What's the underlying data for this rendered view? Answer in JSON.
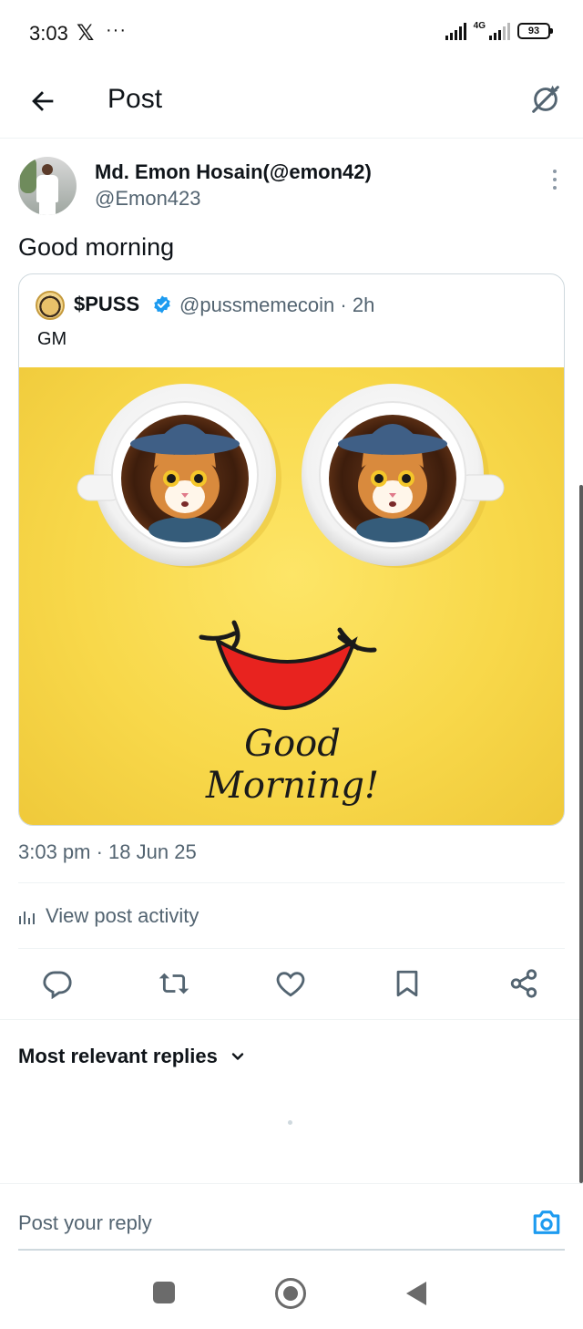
{
  "status_bar": {
    "time": "3:03",
    "app_glyph": "𝕏",
    "dots": "···",
    "network": "4G",
    "battery": "93"
  },
  "header": {
    "title": "Post",
    "icons": [
      "back-arrow-icon",
      "grok-icon"
    ]
  },
  "post": {
    "author_name": "Md. Emon Hosain(@emon42)",
    "author_handle": "@Emon423",
    "text": "Good morning",
    "timestamp": "3:03 pm · 18 Jun 25",
    "view_activity_label": "View post activity"
  },
  "quoted": {
    "name": "$PUSS",
    "handle_time": "@pussmemecoin · 2h",
    "text": "GM",
    "image_caption": "Good Morning!"
  },
  "actions": [
    "reply-icon",
    "repost-icon",
    "like-icon",
    "bookmark-icon",
    "share-icon"
  ],
  "replies": {
    "sort_label": "Most relevant replies"
  },
  "reply_bar": {
    "placeholder": "Post your reply"
  },
  "colors": {
    "accent": "#1d9bf0",
    "secondary_text": "#536471",
    "image_background": "#f8d84a",
    "smile_red": "#e8231f"
  }
}
